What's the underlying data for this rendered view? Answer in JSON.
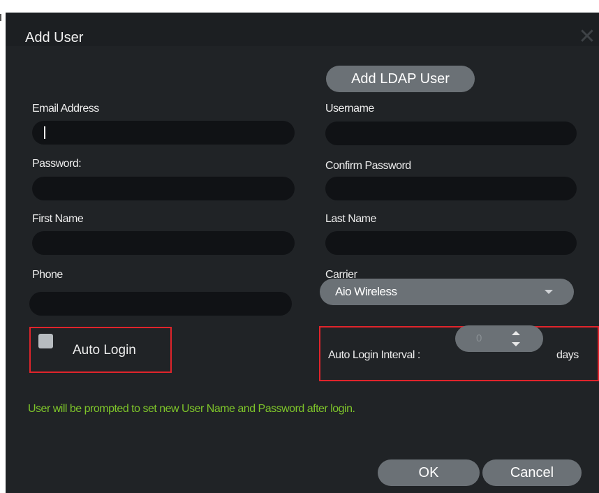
{
  "dialog": {
    "title": "Add User",
    "close_icon": "close-icon"
  },
  "buttons": {
    "add_ldap": "Add LDAP User",
    "ok": "OK",
    "cancel": "Cancel"
  },
  "fields": {
    "email": {
      "label": "Email Address",
      "value": ""
    },
    "username": {
      "label": "Username",
      "value": ""
    },
    "password": {
      "label": "Password:",
      "value": ""
    },
    "confirm_password": {
      "label": "Confirm Password",
      "value": ""
    },
    "first_name": {
      "label": "First Name",
      "value": ""
    },
    "last_name": {
      "label": "Last Name",
      "value": ""
    },
    "phone": {
      "label": "Phone",
      "value": ""
    },
    "carrier": {
      "label": "Carrier",
      "selected": "Aio Wireless"
    }
  },
  "auto_login": {
    "label": "Auto Login",
    "checked": false,
    "interval_label": "Auto Login Interval :",
    "interval_value": "0",
    "interval_unit": "days"
  },
  "note": "User will be prompted to set new User Name and Password after login.",
  "colors": {
    "dialog_bg": "#202326",
    "field_bg": "#101215",
    "button_bg": "#6b7176",
    "highlight": "#e0242b",
    "note_text": "#7ec52a"
  }
}
